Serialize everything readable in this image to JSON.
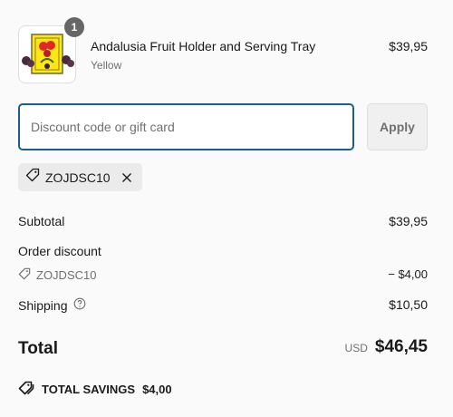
{
  "cart_item": {
    "quantity": "1",
    "name": "Andalusia Fruit Holder and Serving Tray",
    "variant": "Yellow",
    "price": "$39,95"
  },
  "discount": {
    "placeholder": "Discount code or gift card",
    "value": "",
    "apply_label": "Apply",
    "applied_code": "ZOJDSC10"
  },
  "summary": {
    "subtotal_label": "Subtotal",
    "subtotal_value": "$39,95",
    "order_discount_label": "Order discount",
    "discount_code": "ZOJDSC10",
    "discount_value": "− $4,00",
    "shipping_label": "Shipping",
    "shipping_value": "$10,50",
    "total_label": "Total",
    "currency": "USD",
    "total_value": "$46,45"
  },
  "savings": {
    "label": "TOTAL SAVINGS",
    "value": "$4,00"
  },
  "colors": {
    "accent": "#1a5e8a",
    "muted_text": "#707070",
    "chip_bg": "#ebebeb",
    "badge_bg": "#666666"
  }
}
